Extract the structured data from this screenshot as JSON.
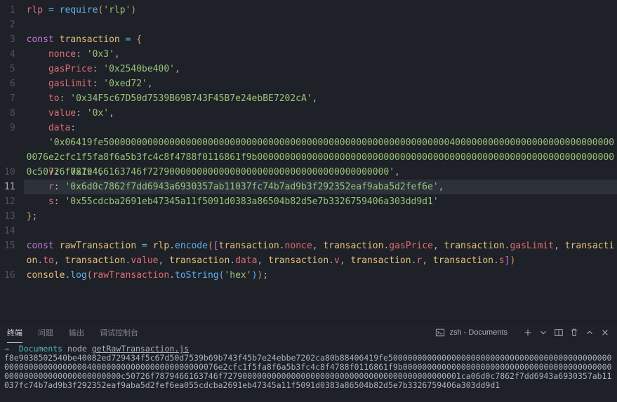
{
  "code": {
    "l1": {
      "rlp": "rlp",
      "require": "require",
      "arg": "'rlp'"
    },
    "l3": {
      "const": "const",
      "name": "transaction",
      "open": "{"
    },
    "l4": {
      "key": "nonce",
      "val": "'0x3'"
    },
    "l5": {
      "key": "gasPrice",
      "val": "'0x2540be400'"
    },
    "l6": {
      "key": "gasLimit",
      "val": "'0xed72'"
    },
    "l7": {
      "key": "to",
      "val": "'0x34F5c67D50d7539B69B743F45B7e24ebBE7202cA'"
    },
    "l8": {
      "key": "value",
      "val": "'0x'"
    },
    "l9": {
      "key": "data",
      "val": "'0x06419fe5000000000000000000000000000000000000000000000000000000000000004000000000000000000000000000000076e2cfc1f5fa8f6a5b3fc4c8f4788f0116861f9b000000000000000000000000000000000000000000000000000000000000000000c50726f7879466163746f72790000000000000000000000000000000000000000'"
    },
    "l10": {
      "key": "v",
      "val": "'0x1c'"
    },
    "l11": {
      "key": "r",
      "val": "'0x6d0c7862f7dd6943a6930357ab11037fc74b7ad9b3f292352eaf9aba5d2fef6e'"
    },
    "l12": {
      "key": "s",
      "val": "'0x55cdcba2691eb47345a11f5091d0383a86504b82d5e7b3326759406a303dd9d1'"
    },
    "l13": {
      "close": "}"
    },
    "l15": {
      "const": "const",
      "name": "rawTransaction",
      "rlp": "rlp",
      "encode": "encode",
      "items": [
        "nonce",
        "gasPrice",
        "gasLimit",
        "to",
        "value",
        "data",
        "v",
        "r",
        "s"
      ],
      "obj": "transaction"
    },
    "l16": {
      "console": "console",
      "log": "log",
      "raw": "rawTransaction",
      "toString": "toString",
      "arg": "'hex'"
    }
  },
  "panel": {
    "tabs": {
      "terminal": "终端",
      "problems": "问题",
      "output": "输出",
      "debug": "调试控制台"
    },
    "shell": "zsh - Documents",
    "prompt": {
      "arrow": "→",
      "cwd": "Documents",
      "cmd": "node",
      "file": "getRawTransaction.js"
    },
    "output": "f8e9038502540be40082ed729434f5c67d50d7539b69b743f45b7e24ebbe7202ca80b88406419fe500000000000000000000000000000000000000000000000000000000000000400000000000000000000000076e2cfc1f5fa8f6a5b3fc4c8f4788f0116861f9b0000000000000000000000000000000000000000000000000000000000000000000c50726f7879466163746f7279000000000000000000000000000000000000000000001ca06d0c7862f7dd6943a6930357ab11037fc74b7ad9b3f292352eaf9aba5d2fef6ea055cdcba2691eb47345a11f5091d0383a86504b82d5e7b3326759406a303dd9d1"
  },
  "line_numbers": [
    "1",
    "2",
    "3",
    "4",
    "5",
    "6",
    "7",
    "8",
    "9",
    "10",
    "11",
    "12",
    "13",
    "14",
    "15",
    "16"
  ]
}
